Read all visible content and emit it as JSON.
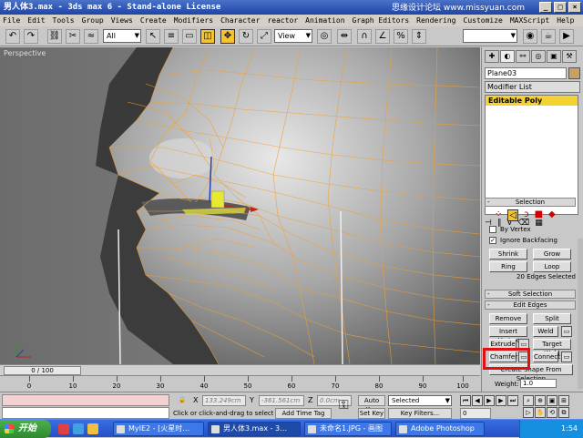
{
  "window": {
    "title": "男人体3.max - 3ds max 6 - Stand-alone License",
    "watermark": "思缘设计论坛 www.missyuan.com"
  },
  "menu": [
    "File",
    "Edit",
    "Tools",
    "Group",
    "Views",
    "Create",
    "Modifiers",
    "Character",
    "reactor",
    "Animation",
    "Graph Editors",
    "Rendering",
    "Customize",
    "MAXScript",
    "Help"
  ],
  "toolbar": {
    "selection_filter": "All",
    "ref_coord": "View"
  },
  "viewport": {
    "label": "Perspective"
  },
  "panel": {
    "object_name": "Plane03",
    "modifier_list": "Modifier List",
    "stack_item": "Editable Poly",
    "selection": {
      "title": "Selection",
      "by_vertex": "By Vertex",
      "ignore_backfacing": "Ignore Backfacing",
      "shrink": "Shrink",
      "grow": "Grow",
      "ring": "Ring",
      "loop": "Loop",
      "status": "20 Edges Selected"
    },
    "soft_selection": {
      "title": "Soft Selection"
    },
    "edit_edges": {
      "title": "Edit Edges",
      "remove": "Remove",
      "split": "Split",
      "insert_vertex": "Insert Vertex",
      "weld": "Weld",
      "extrude": "Extrude",
      "target_weld": "Target Weld",
      "chamfer": "Chamfer",
      "connect": "Connect",
      "create_shape": "Create Shape From Selection",
      "weight_label": "Weight:",
      "weight_value": "1.0"
    }
  },
  "timeline": {
    "frame": "0 / 100",
    "ticks": [
      "0",
      "10",
      "20",
      "30",
      "40",
      "50",
      "60",
      "70",
      "80",
      "90",
      "100"
    ]
  },
  "status": {
    "prompt": "Click or click-and-drag to select obj",
    "x_label": "X",
    "x_value": "133.249cm",
    "y_label": "Y",
    "y_value": "-361.561cm",
    "z_label": "Z",
    "z_value": "0.0cm",
    "auto_key": "Auto Key",
    "set_key": "Set Key",
    "key_mode": "Selected",
    "key_filters": "Key Filters...",
    "add_time_tag": "Add Time Tag",
    "frame_num": "0"
  },
  "taskbar": {
    "start": "开始",
    "tasks": [
      "MyIE2 - [火星时…",
      "男人体3.max - 3…",
      "未命名1.JPG - 画图",
      "Adobe Photoshop"
    ],
    "time": "1:54"
  },
  "colors": {
    "wire": "#f0a030",
    "highlight": "#e01010",
    "stack": "#f4d232"
  }
}
